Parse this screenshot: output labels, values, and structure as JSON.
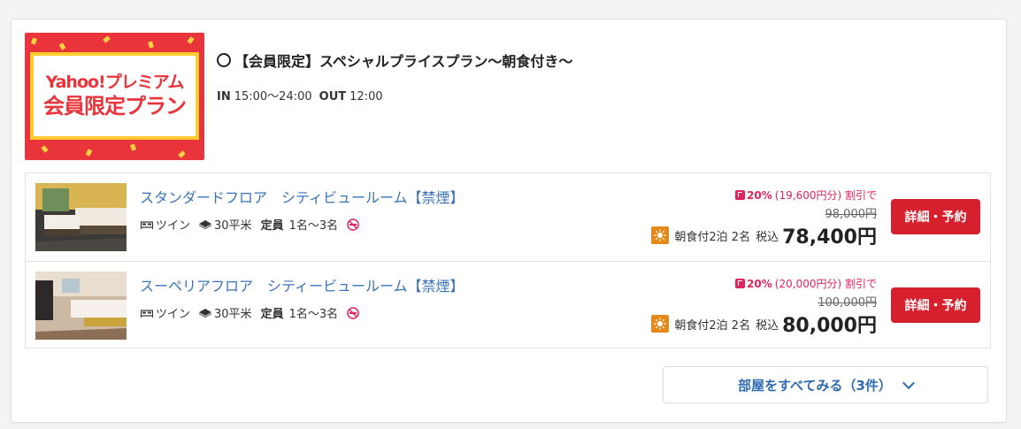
{
  "plan": {
    "banner": {
      "line1": "Yahoo!プレミアム",
      "line2": "会員限定プラン",
      "colors": {
        "background": "#e8343a",
        "frame": "#ffcb2f"
      }
    },
    "title": "【会員限定】スペシャルプライスプラン〜朝食付き〜",
    "checkin_label": "IN",
    "checkin_time": "15:00〜24:00",
    "checkout_label": "OUT",
    "checkout_time": "12:00"
  },
  "rooms": [
    {
      "name": "スタンダードフロア　シティビュールーム【禁煙】",
      "bed_type": "ツイン",
      "area": "30平米",
      "capacity_label": "定員",
      "capacity": "1名〜3名",
      "discount_pct": "20%",
      "discount_amount": "(19,600円分)",
      "discount_suffix": "割引で",
      "original_price": "98,000円",
      "meal_stay": "朝食付2泊 2名",
      "tax_label": "税込",
      "price": "78,400円",
      "button": "詳細・予約"
    },
    {
      "name": "スーペリアフロア　シティービュールーム【禁煙】",
      "bed_type": "ツイン",
      "area": "30平米",
      "capacity_label": "定員",
      "capacity": "1名〜3名",
      "discount_pct": "20%",
      "discount_amount": "(20,000円分)",
      "discount_suffix": "割引で",
      "original_price": "100,000円",
      "meal_stay": "朝食付2泊 2名",
      "tax_label": "税込",
      "price": "80,000円",
      "button": "詳細・予約"
    }
  ],
  "see_all": "部屋をすべてみる（3件）",
  "icons": [
    "circle-icon",
    "bed-icon",
    "area-icon",
    "no-smoking-icon",
    "paypay-icon",
    "sun-icon",
    "chevron-down-icon"
  ],
  "colors": {
    "link": "#3a73b8",
    "accent_red": "#d6202e",
    "discount": "#e0245e",
    "meal_icon": "#e48a1a"
  }
}
